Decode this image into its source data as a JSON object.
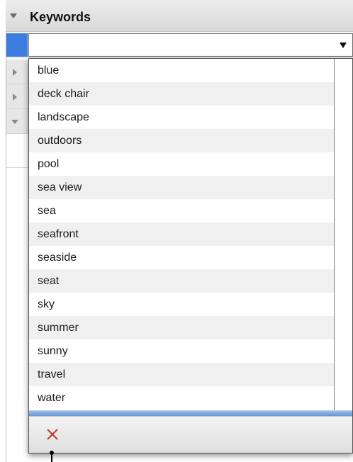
{
  "panel": {
    "title": "Keywords"
  },
  "keyword_field": {
    "value": ""
  },
  "dropdown": {
    "items": [
      "blue",
      "deck chair",
      "landscape",
      "outdoors",
      "pool",
      "sea view",
      "sea",
      "seafront",
      "seaside",
      "seat",
      "sky",
      "summer",
      "sunny",
      "travel",
      "water"
    ]
  },
  "icons": {
    "header_toggle": "disclosure-triangle-down-icon",
    "combo_arrow": "dropdown-arrow-icon",
    "clear": "clear-x-icon"
  },
  "colors": {
    "selection_blue": "#3d7de0",
    "clear_icon_red": "#c0392b"
  }
}
